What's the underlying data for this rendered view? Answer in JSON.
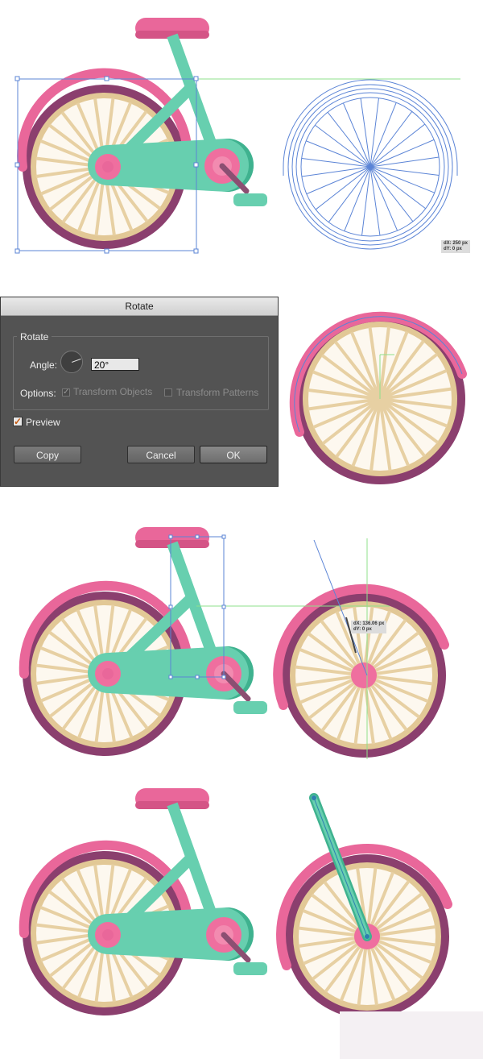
{
  "colors": {
    "frame": "#67cfaf",
    "frame_dark": "#3fb28f",
    "fender": "#e9679a",
    "tire": "#8b3f6e",
    "rim": "#e2c896",
    "spoke": "#e7d0a3",
    "hub": "#ef6f9f",
    "crank_arm": "#8b4f72",
    "selection": "#5b84d6",
    "smart_guide": "#8fe08b"
  },
  "step1": {
    "readout": {
      "line1": "dX: 250 px",
      "line2": "dY: 0 px"
    }
  },
  "dialog": {
    "title": "Rotate",
    "group_label": "Rotate",
    "angle_label": "Angle:",
    "angle_value": "20°",
    "options_label": "Options:",
    "transform_objects": "Transform Objects",
    "transform_patterns": "Transform Patterns",
    "preview_label": "Preview",
    "preview_checked": true,
    "copy_button": "Copy",
    "cancel_button": "Cancel",
    "ok_button": "OK"
  },
  "step3": {
    "readout": {
      "line1": "dX: 136.06 px",
      "line2": "dY: 0 px"
    }
  },
  "icons": [
    "rotate-dial-icon",
    "checkbox-icon",
    "checkmark-icon"
  ]
}
